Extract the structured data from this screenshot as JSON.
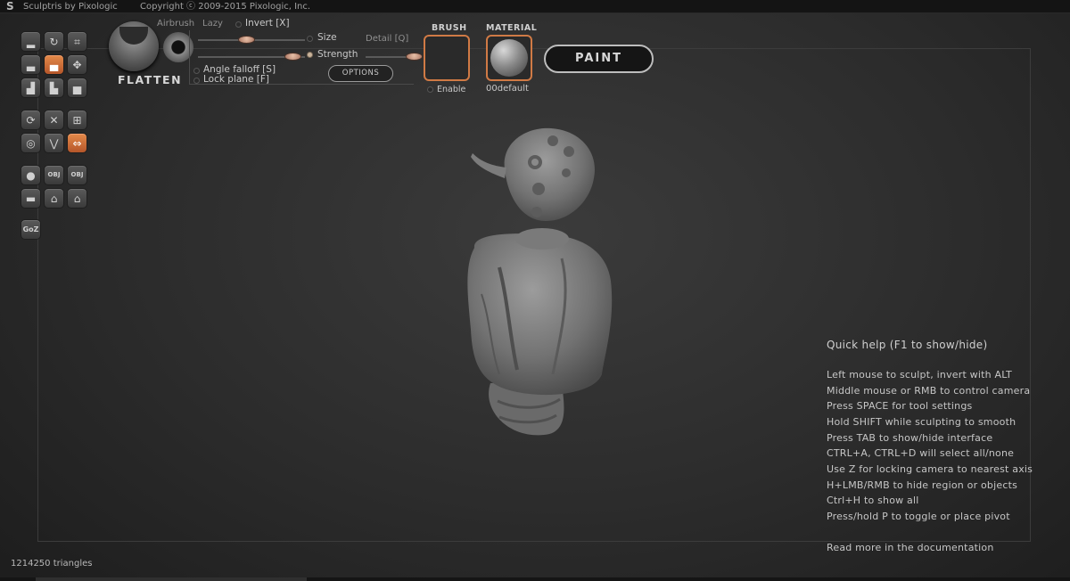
{
  "titlebar": {
    "app_title": "Sculptris by Pixologic",
    "copyright": "Copyright ⓒ 2009-2015 Pixologic, Inc."
  },
  "toolbar": {
    "rows": [
      [
        "draw-icon",
        "rotate-icon",
        "scale-icon"
      ],
      [
        "inflate-icon",
        "flatten-icon",
        "grab-icon"
      ],
      [
        "pinch-icon",
        "crease-icon",
        "smooth-icon"
      ],
      [
        "symmetry-icon",
        "wireframe-icon",
        "grid-icon"
      ],
      [
        "reduce-brush-icon",
        "reduce-selected-icon",
        "mirror-icon"
      ],
      [
        "new-sphere-icon",
        "import-obj-icon",
        "export-obj-icon"
      ],
      [
        "new-plane-icon",
        "open-file-icon",
        "save-file-icon"
      ]
    ],
    "goz_label": "GoZ"
  },
  "brush_settings": {
    "tool_name": "FLATTEN",
    "airbrush_label": "Airbrush",
    "lazy_label": "Lazy",
    "invert_label": "Invert [X]",
    "size_label": "Size",
    "strength_label": "Strength",
    "detail_label": "Detail [Q]",
    "angle_falloff_label": "Angle falloff [S]",
    "lock_plane_label": "Lock plane [F]",
    "options_label": "OPTIONS",
    "size_value": 0.45,
    "strength_value": 0.88,
    "detail_value": 0.9
  },
  "brush": {
    "title": "BRUSH",
    "enable_label": "Enable"
  },
  "material": {
    "title": "MATERIAL",
    "name": "00default"
  },
  "paint_label": "PAINT",
  "quick_help": {
    "title": "Quick help (F1 to show/hide)",
    "lines": [
      "Left mouse to sculpt, invert with ALT",
      "Middle mouse or RMB to control camera",
      "Press SPACE for tool settings",
      "Hold SHIFT while sculpting to smooth",
      "Press TAB to show/hide interface",
      "CTRL+A, CTRL+D will select all/none",
      "Use Z for locking camera to nearest axis",
      "H+LMB/RMB to hide region or objects",
      "Ctrl+H to show all",
      "Press/hold P to toggle or place pivot"
    ],
    "docs_link": "Read more in the documentation"
  },
  "status": {
    "triangles": "1214250 triangles"
  }
}
